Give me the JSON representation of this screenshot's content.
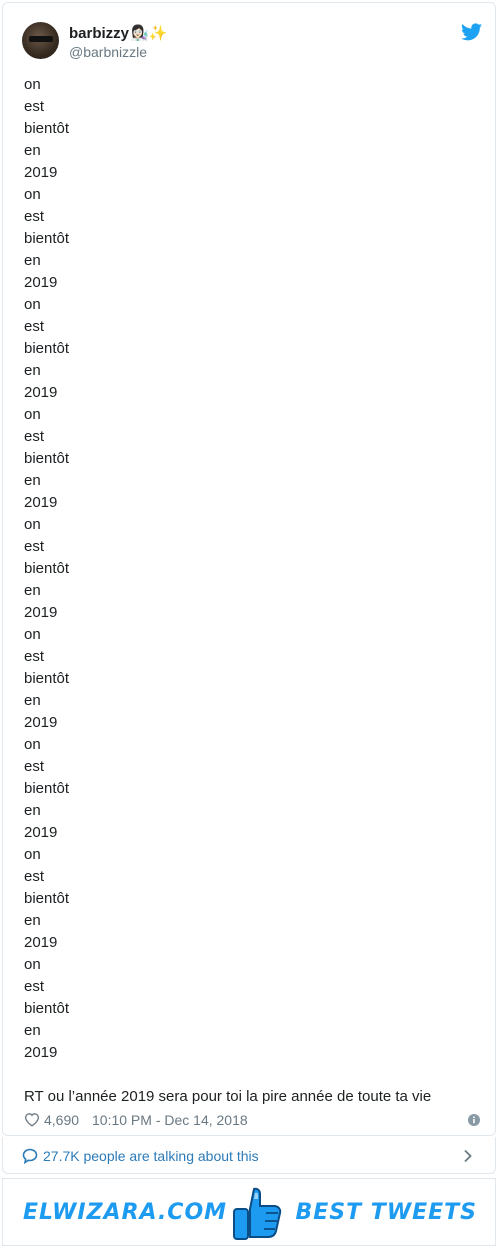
{
  "tweet": {
    "display_name": "barbizzy",
    "name_emoji": "👩🏻‍🔬✨",
    "handle": "@barbnizzle",
    "lines": [
      "on",
      "est",
      "bientôt",
      "en",
      "2019",
      "on",
      "est",
      "bientôt",
      "en",
      "2019",
      "on",
      "est",
      "bientôt",
      "en",
      "2019",
      "on",
      "est",
      "bientôt",
      "en",
      "2019",
      "on",
      "est",
      "bientôt",
      "en",
      "2019",
      "on",
      "est",
      "bientôt",
      "en",
      "2019",
      "on",
      "est",
      "bientôt",
      "en",
      "2019",
      "on",
      "est",
      "bientôt",
      "en",
      "2019",
      "on",
      "est",
      "bientôt",
      "en",
      "2019"
    ],
    "final_line": "RT ou l’année 2019 sera pour toi la pire année de toute ta vie",
    "likes": "4,690",
    "timestamp": "10:10 PM - Dec 14, 2018",
    "talking": "27.7K people are talking about this"
  },
  "banner": {
    "left_text": "ELWIZARA.COM",
    "right_text": "BEST TWEETS"
  },
  "icons": {
    "bird": "twitter-bird-icon",
    "heart": "heart-icon",
    "info": "info-icon",
    "talk": "speech-bubble-icon",
    "chevron": "chevron-right-icon",
    "thumb": "thumbs-up-icon"
  },
  "colors": {
    "twitter_blue": "#1da1f2",
    "link_blue": "#2b7bb9",
    "muted": "#697882",
    "text": "#1c2022",
    "brand_blue": "#1d9bf0"
  }
}
